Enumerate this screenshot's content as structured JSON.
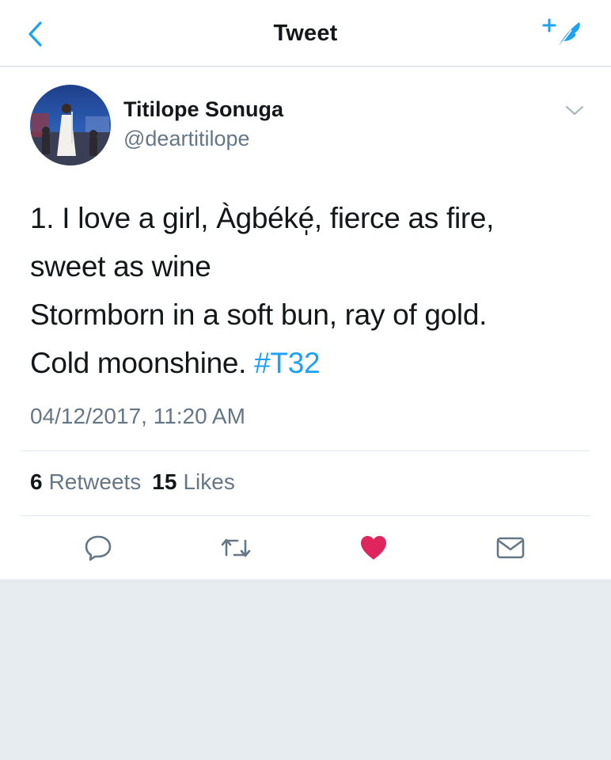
{
  "header": {
    "title": "Tweet",
    "back_icon": "chevron-left-icon",
    "compose_icon": "compose-tweet-icon",
    "accent_color": "#1da1f2"
  },
  "tweet": {
    "author": {
      "display_name": "Titilope Sonuga",
      "handle": "@deartitilope"
    },
    "text_lines": [
      "1. I love a girl, Àgbéké̩, fierce as fire,",
      "sweet as wine",
      "Stormborn in a soft bun, ray of gold.",
      "Cold moonshine."
    ],
    "hashtag": "#T32",
    "timestamp": "04/12/2017, 11:20 AM",
    "stats": {
      "retweets_count": "6",
      "retweets_label": "Retweets",
      "likes_count": "15",
      "likes_label": "Likes"
    },
    "actions": {
      "reply_icon": "reply-icon",
      "retweet_icon": "retweet-icon",
      "like_icon": "heart-icon",
      "liked": true,
      "like_color": "#e0245e",
      "share_icon": "envelope-icon"
    }
  }
}
